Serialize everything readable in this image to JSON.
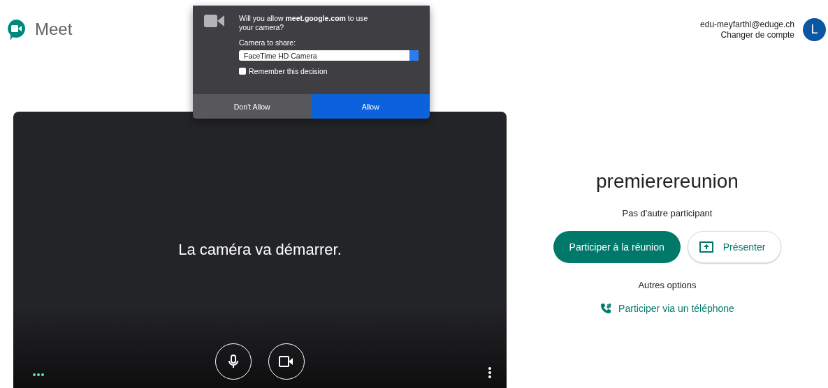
{
  "header": {
    "app_name": "Meet",
    "account_email": "edu-meyfarthl@eduge.ch",
    "switch_account": "Changer de compte",
    "avatar_letter": "L"
  },
  "permission_dialog": {
    "message": "Will you allow **meet.google.com** to use your camera?",
    "camera_label": "Camera to share:",
    "camera_value": "FaceTime HD Camera",
    "remember": {
      "label": "Remember this decision",
      "checked": false
    },
    "buttons": [
      {
        "label": "Don’t Allow",
        "primary": false
      },
      {
        "label": "Allow",
        "primary": true
      }
    ]
  },
  "video_preview": {
    "message": "La caméra va démarrer."
  },
  "join_panel": {
    "meeting_name": "premierereunion",
    "participants": "Pas d'autre participant",
    "join_button": "Participer à la réunion",
    "present_button": "Présenter",
    "other_options": "Autres options",
    "phone_link": "Participer via un téléphone"
  }
}
